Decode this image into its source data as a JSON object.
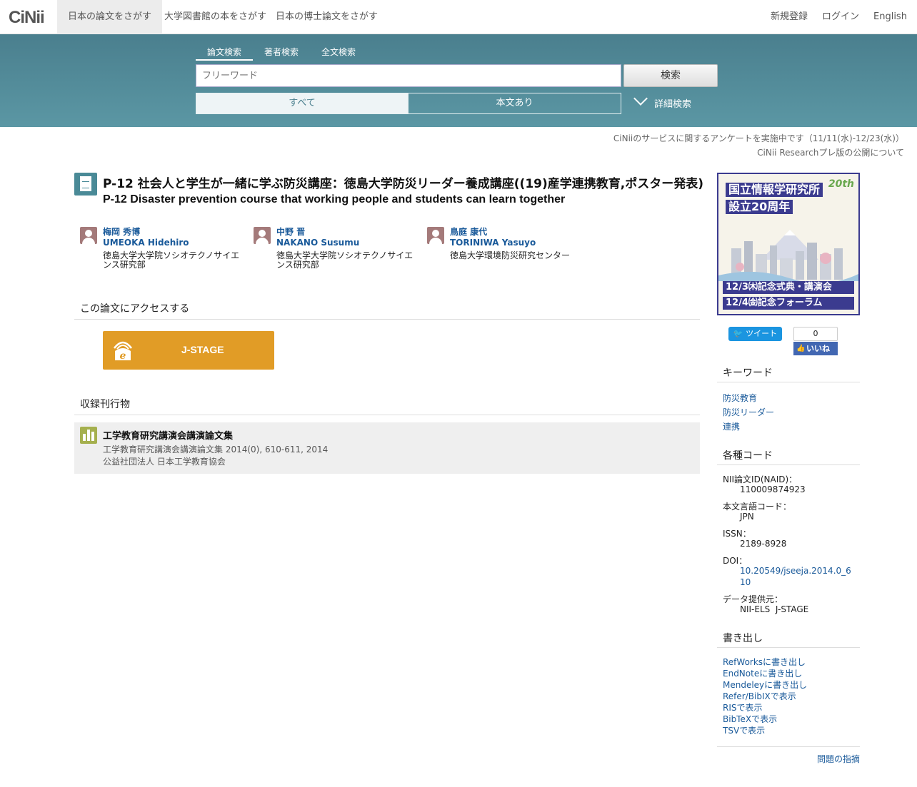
{
  "nav": {
    "logo": "CiNii",
    "tabs": [
      "日本の論文をさがす",
      "大学図書館の本をさがす",
      "日本の博士論文をさがす"
    ],
    "right": [
      "新規登録",
      "ログイン",
      "English"
    ]
  },
  "search": {
    "tabs": [
      "論文検索",
      "著者検索",
      "全文検索"
    ],
    "placeholder": "フリーワード",
    "button": "検索",
    "filters": [
      "すべて",
      "本文あり"
    ],
    "advanced": "詳細検索"
  },
  "notices": [
    "CiNiiのサービスに関するアンケートを実施中です（11/11(水)-12/23(水)）",
    "CiNii Researchプレ版の公開について"
  ],
  "article": {
    "title_ja": "P-12 社会人と学生が一緒に学ぶ防災講座：徳島大学防災リーダー養成講座((19)産学連携教育,ポスター発表)",
    "title_en": "P-12 Disaster prevention course that working people and students can learn together",
    "authors": [
      {
        "name_ja": "梅岡 秀博",
        "name_en": "UMEOKA Hidehiro",
        "affiliation": "徳島大学大学院ソシオテクノサイエンス研究部"
      },
      {
        "name_ja": "中野 晋",
        "name_en": "NAKANO Susumu",
        "affiliation": "徳島大学大学院ソシオテクノサイエンス研究部"
      },
      {
        "name_ja": "鳥庭 康代",
        "name_en": "TORINIWA Yasuyo",
        "affiliation": "徳島大学環境防災研究センター"
      }
    ],
    "access_heading": "この論文にアクセスする",
    "access_button": "J-STAGE",
    "journal_heading": "収録刊行物",
    "journal": {
      "title": "工学教育研究講演会講演論文集",
      "citation": "工学教育研究講演会講演論文集 2014(0), 610-611, 2014",
      "publisher": "公益社団法人 日本工学教育協会"
    }
  },
  "banner": {
    "line1": "国立情報学研究所",
    "line2": "設立20周年",
    "badge": "20th",
    "event1": "12/3㈭記念式典・講演会",
    "event2": "12/4㈮記念フォーラム"
  },
  "social": {
    "tweet": "ツイート",
    "fb_count": "0",
    "fb_like": "いいね"
  },
  "sidebar": {
    "keywords_heading": "キーワード",
    "keywords": [
      "防災教育",
      "防災リーダー",
      "連携"
    ],
    "codes_heading": "各種コード",
    "codes": [
      {
        "key": "NII論文ID(NAID)：",
        "value": "110009874923"
      },
      {
        "key": "本文言語コード：",
        "value": "JPN"
      },
      {
        "key": "ISSN：",
        "value": "2189-8928"
      },
      {
        "key": "DOI：",
        "value": "10.20549/jseeja.2014.0_610"
      },
      {
        "key": "データ提供元：",
        "value": "NII-ELS  J-STAGE"
      }
    ],
    "export_heading": "書き出し",
    "exports": [
      "RefWorksに書き出し",
      "EndNoteに書き出し",
      "Mendeleyに書き出し",
      "Refer/BibIXで表示",
      "RISで表示",
      "BibTeXで表示",
      "TSVで表示"
    ],
    "report": "問題の指摘"
  }
}
